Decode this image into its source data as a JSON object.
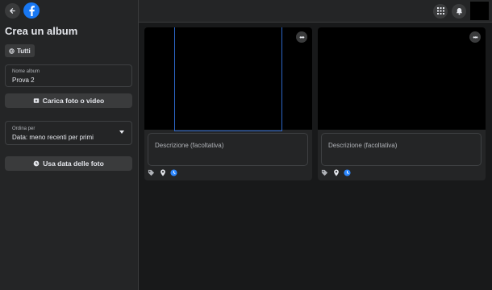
{
  "sidebar": {
    "title": "Crea un album",
    "privacy_label": "Tutti",
    "album_name": {
      "label": "Nome album",
      "value": "Prova 2"
    },
    "upload_label": "Carica foto o video",
    "sort": {
      "label": "Ordina per",
      "value": "Data: meno recenti per primi"
    },
    "date_button_label": "Usa data delle foto"
  },
  "cards": [
    {
      "description_placeholder": "Descrizione (facoltativa)"
    },
    {
      "description_placeholder": "Descrizione (facoltativa)"
    }
  ],
  "icons": {
    "back": "back-arrow-icon",
    "logo": "facebook-logo",
    "menu": "grid-menu-icon",
    "notifications": "bell-icon",
    "privacy": "globe-icon",
    "upload": "photo-add-icon",
    "sort_dropdown": "caret-down-icon",
    "date": "clock-icon",
    "tag": "tag-icon",
    "location": "location-pin-icon",
    "time": "clock-icon"
  },
  "colors": {
    "background": "#18191a",
    "surface": "#242526",
    "button": "#3a3b3c",
    "brand": "#1877f2",
    "selection": "#2d67c9"
  }
}
